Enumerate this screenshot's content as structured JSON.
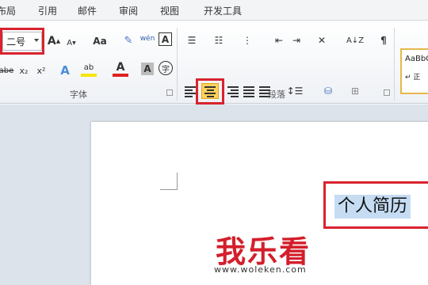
{
  "menu": {
    "tabs": [
      "布局",
      "引用",
      "邮件",
      "审阅",
      "视图",
      "开发工具"
    ]
  },
  "ribbon": {
    "font_size_value": "二号",
    "font_group_label": "字体",
    "paragraph_group_label": "段落",
    "font_buttons": {
      "grow": "A",
      "shrink": "A",
      "change_case": "Aa",
      "clear": "A",
      "phonetic": "wén",
      "border_char": "A",
      "strike": "abe",
      "subscript": "x₂",
      "superscript": "x²",
      "text_effect": "A",
      "highlight": "ab",
      "font_color": "A",
      "char_shading": "A",
      "enclose": "字"
    },
    "styles_preview": "AaBbC",
    "styles_sub": "↵ 正"
  },
  "document": {
    "selected_text": "个人简历"
  },
  "watermark": {
    "title": "我乐看",
    "url": "www.woleken.com"
  },
  "colors": {
    "highlight_box": "#d9232e",
    "active_button": "#ffd35c",
    "selection": "#c5dcf3"
  }
}
